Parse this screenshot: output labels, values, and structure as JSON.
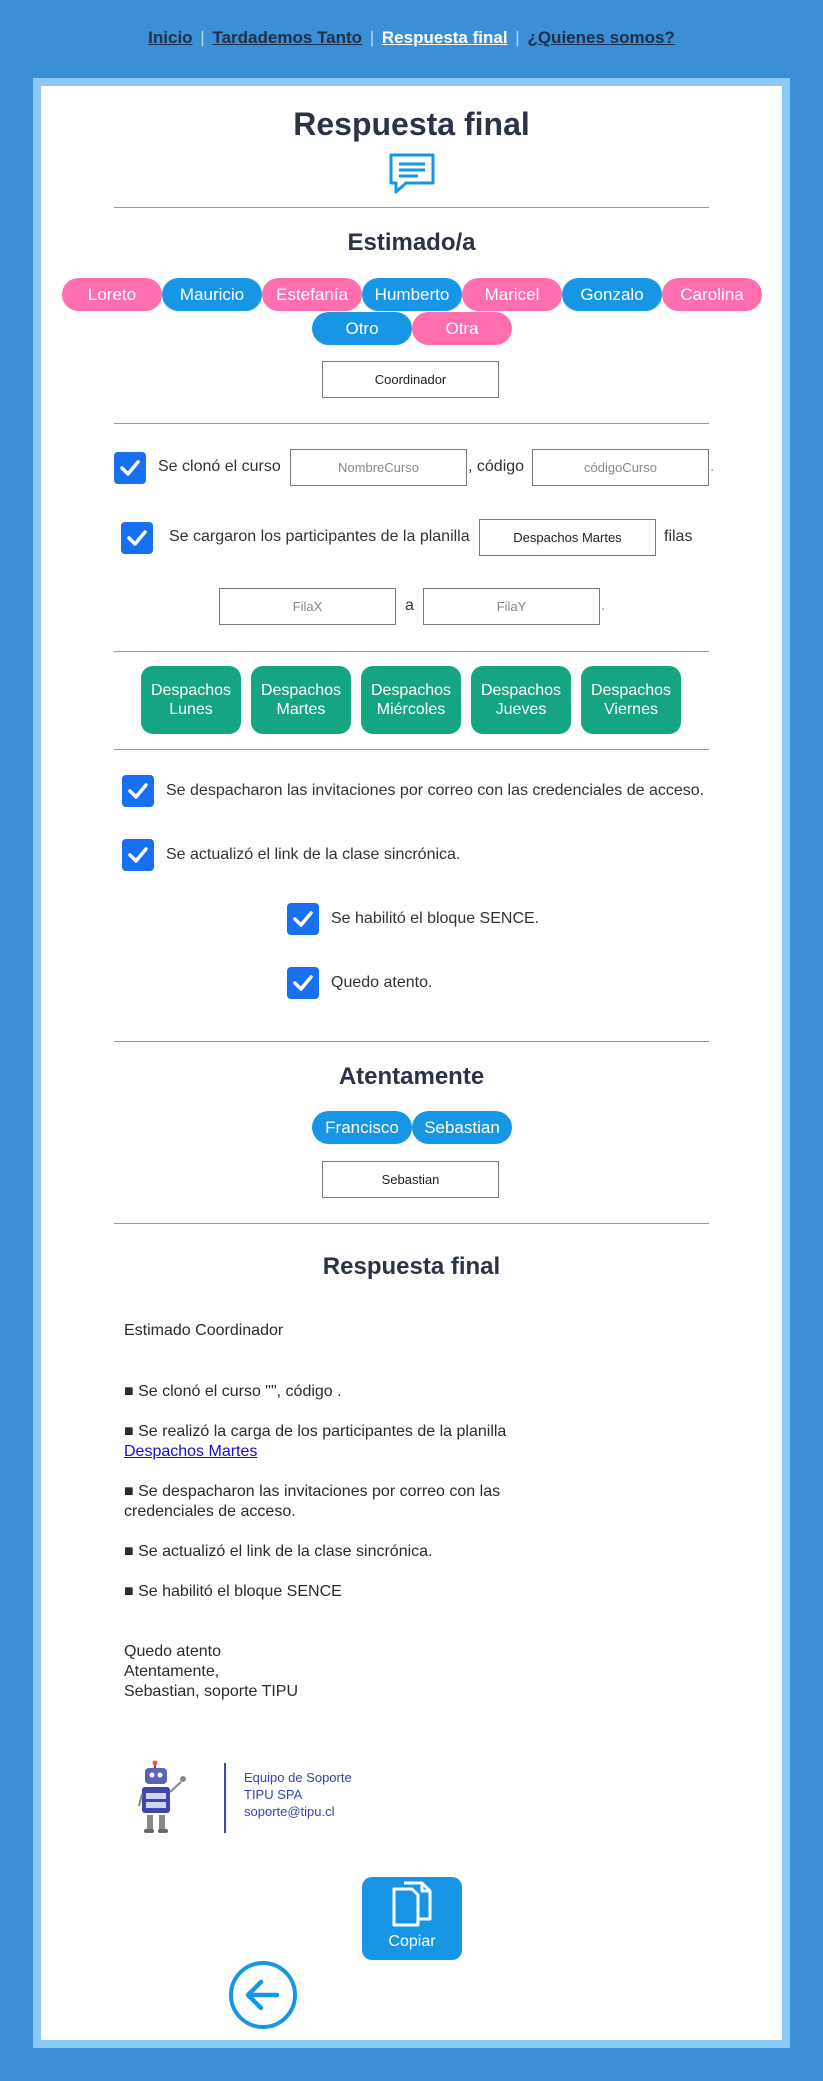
{
  "nav": {
    "items": [
      "Inicio",
      "Tardademos Tanto",
      "Respuesta final",
      "¿Quienes somos?"
    ],
    "separator": "|"
  },
  "page_title": "Respuesta final",
  "greeting": {
    "heading": "Estimado/a",
    "names": [
      "Loreto",
      "Mauricio",
      "Estefanía",
      "Humberto",
      "Maricel",
      "Gonzalo",
      "Carolina",
      "Otro",
      "Otra"
    ],
    "value": "Coordinador"
  },
  "clone": {
    "label": "Se clonó el curso",
    "course_placeholder": "NombreCurso",
    "code_label": ", código",
    "code_placeholder": "códigoCurso",
    "end": "."
  },
  "load": {
    "label": "Se cargaron los participantes de la planilla",
    "sheet_value": "Despachos Martes",
    "rows_label": "filas",
    "from_placeholder": "FilaX",
    "to_label": "a",
    "to_placeholder": "FilaY",
    "end": "."
  },
  "sheets": [
    [
      "Despachos",
      "Lunes"
    ],
    [
      "Despachos",
      "Martes"
    ],
    [
      "Despachos",
      "Miércoles"
    ],
    [
      "Despachos",
      "Jueves"
    ],
    [
      "Despachos",
      "Viernes"
    ]
  ],
  "checks": {
    "invites": "Se despacharon las invitaciones por correo con las credenciales de acceso.",
    "link": "Se actualizó el link de la clase sincrónica.",
    "sence": "Se habilitó el bloque SENCE.",
    "attentive": "Quedo atento."
  },
  "signoff": {
    "heading": "Atentamente",
    "names": [
      "Francisco",
      "Sebastian"
    ],
    "value": "Sebastian"
  },
  "result": {
    "heading": "Respuesta final",
    "greeting": "Estimado Coordinador",
    "line_clone": "■ Se clonó el curso \"\", código .",
    "line_load": "■ Se realizó la carga de los participantes de la planilla",
    "line_load_link": "Despachos Martes",
    "line_invites_1": "■ Se despacharon las invitaciones por correo con las",
    "line_invites_2": "credenciales de acceso.",
    "line_link": "■ Se actualizó el link de la clase sincrónica.",
    "line_sence": "■ Se habilitó el bloque SENCE",
    "closing_1": "Quedo atento",
    "closing_2": "Atentamente,",
    "closing_3": "Sebastian, soporte TIPU"
  },
  "signature": {
    "team": "Equipo de Soporte",
    "company": "TIPU SPA",
    "email": "soporte@tipu.cl"
  },
  "copy_label": "Copiar",
  "icons": [
    "chat-icon",
    "check-icon",
    "robot-logo",
    "copy-icon",
    "back-arrow-icon"
  ],
  "colors": {
    "page_bg": "#3a8fd6",
    "pink": "#ff6fb0",
    "blue": "#1796e6",
    "green": "#15a583",
    "check": "#1670f0"
  }
}
